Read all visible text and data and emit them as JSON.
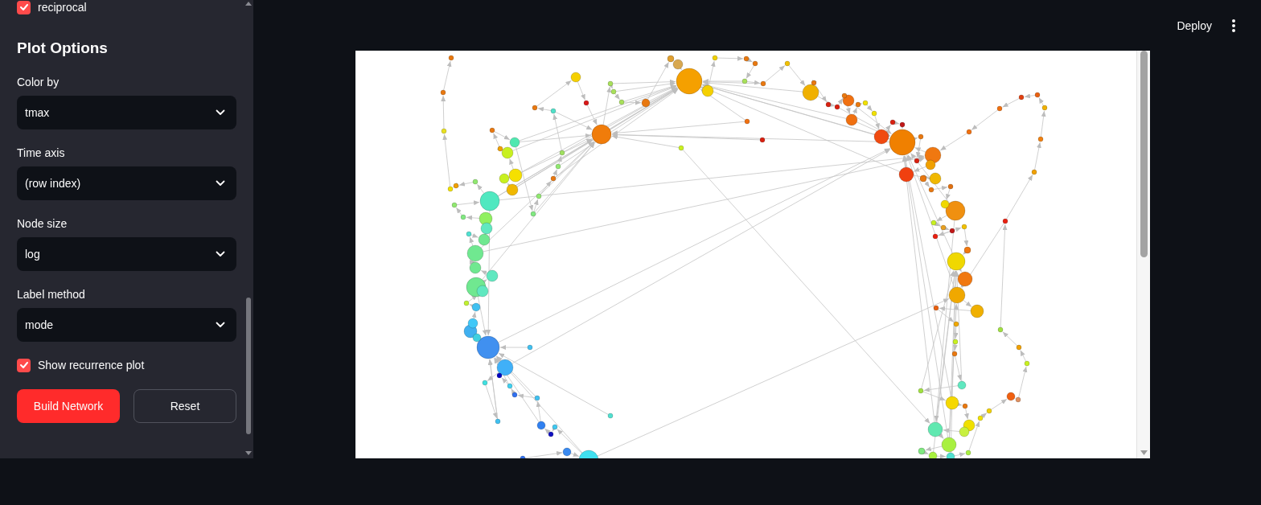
{
  "sidebar": {
    "top_checkbox": {
      "label": "reciprocal",
      "checked": true
    },
    "title": "Plot Options",
    "selects": [
      {
        "label": "Color by",
        "value": "tmax"
      },
      {
        "label": "Time axis",
        "value": "(row index)"
      },
      {
        "label": "Node size",
        "value": "log"
      },
      {
        "label": "Label method",
        "value": "mode"
      }
    ],
    "checkbox": {
      "label": "Show recurrence plot",
      "checked": true
    },
    "buttons": [
      {
        "label": "Build Network",
        "kind": "primary"
      },
      {
        "label": "Reset",
        "kind": "secondary"
      }
    ]
  },
  "header": {
    "deploy_button": "Deploy"
  }
}
